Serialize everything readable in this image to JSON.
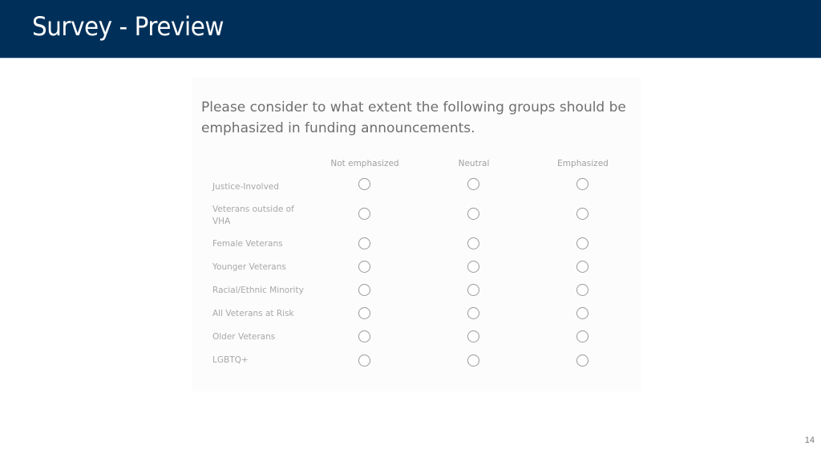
{
  "header": {
    "title": "Survey - Preview",
    "background_color": "#00305a"
  },
  "survey": {
    "question": "Please consider to what extent the following groups should be emphasized in funding announcements.",
    "columns": [
      "Not emphasized",
      "Neutral",
      "Emphasized"
    ],
    "rows": [
      {
        "label": "Justice-Involved",
        "selected": null
      },
      {
        "label": "Veterans outside of VHA",
        "selected": null
      },
      {
        "label": "Female Veterans",
        "selected": null
      },
      {
        "label": "Younger Veterans",
        "selected": null
      },
      {
        "label": "Racial/Ethnic Minority",
        "selected": null
      },
      {
        "label": "All Veterans at Risk",
        "selected": null
      },
      {
        "label": "Older Veterans",
        "selected": null
      },
      {
        "label": "LGBTQ+",
        "selected": null
      }
    ]
  },
  "footer": {
    "page_number": "14"
  }
}
